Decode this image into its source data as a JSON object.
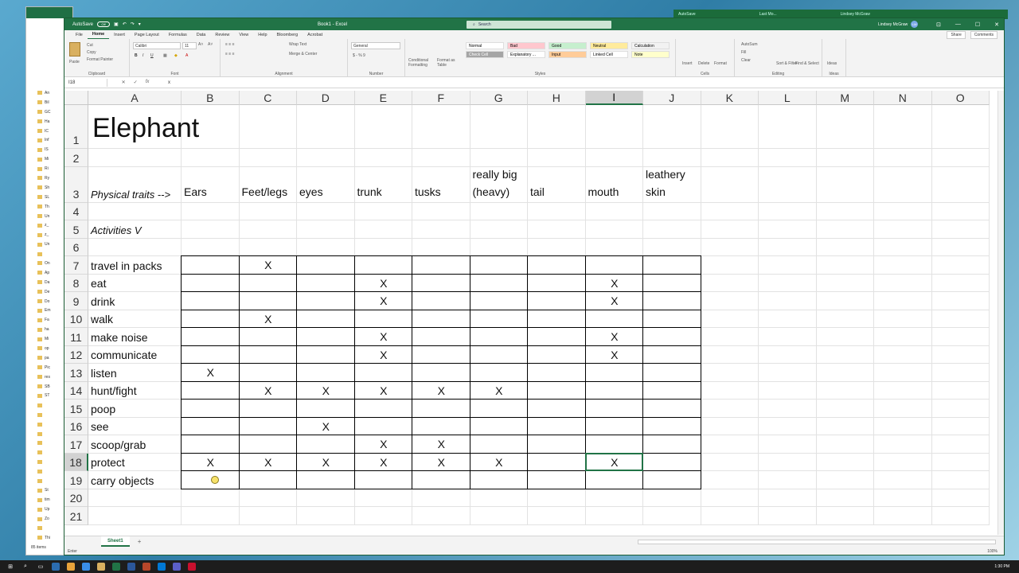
{
  "explorer": {
    "items": [
      "An",
      "Bil",
      "GC",
      "Ha",
      "IC",
      "Inf",
      "IS",
      "Mi",
      "Ri",
      "Ry",
      "Sh",
      "SL",
      "Th",
      "Un",
      "z_",
      "z_",
      "Un",
      "",
      "On",
      "Ap",
      "Da",
      "De",
      "Do",
      "Em",
      "Fa",
      "ha",
      "Mi",
      "op",
      "pa",
      "Pic",
      "res",
      "SB",
      "ST",
      "",
      "",
      "",
      "",
      "",
      "",
      "",
      "",
      "",
      "St",
      "tim",
      "Up",
      "Zo",
      "",
      "Thi"
    ],
    "status": "85 items"
  },
  "bg_window": {
    "left_text": "AutoSave",
    "mid_text": "Last Mo...",
    "user": "Lindsey McGraw"
  },
  "titlebar": {
    "autosave_label": "AutoSave",
    "autosave_state": "Off",
    "doc_title": "Book1 - Excel",
    "search_placeholder": "Search",
    "user_name": "Lindsey McGraw",
    "user_initials": "LM",
    "minimize": "—",
    "restore": "☐",
    "close": "✕"
  },
  "menu": {
    "tabs": [
      "File",
      "Home",
      "Insert",
      "Page Layout",
      "Formulas",
      "Data",
      "Review",
      "View",
      "Help",
      "Bloomberg",
      "Acrobat"
    ],
    "active": "Home",
    "share": "Share",
    "comments": "Comments"
  },
  "ribbon": {
    "clipboard": {
      "label": "Clipboard",
      "paste": "Paste",
      "cut": "Cut",
      "copy": "Copy",
      "format_painter": "Format Painter"
    },
    "font": {
      "label": "Font",
      "name": "Calibri",
      "size": "11",
      "bold": "B",
      "italic": "I",
      "underline": "U"
    },
    "alignment": {
      "label": "Alignment",
      "wrap": "Wrap Text",
      "merge": "Merge & Center"
    },
    "number": {
      "label": "Number",
      "format": "General",
      "symbols": "$ - % 9"
    },
    "styles": {
      "label": "Styles",
      "conditional": "Conditional Formatting",
      "format_as_table": "Format as Table",
      "chips": [
        "Normal",
        "Bad",
        "Good",
        "Neutral",
        "Calculation",
        "Check Cell",
        "Explanatory ...",
        "Input",
        "Linked Cell",
        "Note"
      ]
    },
    "cells": {
      "label": "Cells",
      "insert": "Insert",
      "delete": "Delete",
      "format": "Format"
    },
    "editing": {
      "label": "Editing",
      "autosum": "AutoSum",
      "fill": "Fill",
      "clear": "Clear",
      "sort": "Sort & Filter",
      "find": "Find & Select"
    },
    "ideas": {
      "label": "Ideas",
      "button": "Ideas"
    }
  },
  "formula_bar": {
    "name_box": "I18",
    "cancel": "✕",
    "enter": "✓",
    "fx": "fx",
    "content": "x"
  },
  "sheet": {
    "columns": [
      "A",
      "B",
      "C",
      "D",
      "E",
      "F",
      "G",
      "H",
      "I",
      "J",
      "K",
      "L",
      "M",
      "N",
      "O"
    ],
    "selected_column": "I",
    "selected_row": "18",
    "rows": [
      "1",
      "2",
      "3",
      "4",
      "5",
      "6",
      "7",
      "8",
      "9",
      "10",
      "11",
      "12",
      "13",
      "14",
      "15",
      "16",
      "17",
      "18",
      "19",
      "20",
      "21"
    ],
    "title": "Elephant",
    "traits_label": "Physical traits -->",
    "activities_label": "Activities V",
    "traits": {
      "B": [
        "Ears"
      ],
      "C": [
        "Feet/legs"
      ],
      "D": [
        "eyes"
      ],
      "E": [
        "trunk"
      ],
      "F": [
        "tusks"
      ],
      "G": [
        "really big",
        "(heavy)"
      ],
      "H": [
        "tail"
      ],
      "I": [
        "mouth"
      ],
      "J": [
        "leathery",
        "skin"
      ]
    },
    "activities": [
      {
        "row": "7",
        "label": "travel in packs",
        "x": [
          "C"
        ]
      },
      {
        "row": "8",
        "label": "eat",
        "x": [
          "E",
          "I"
        ]
      },
      {
        "row": "9",
        "label": "drink",
        "x": [
          "E",
          "I"
        ]
      },
      {
        "row": "10",
        "label": "walk",
        "x": [
          "C"
        ]
      },
      {
        "row": "11",
        "label": "make noise",
        "x": [
          "E",
          "I"
        ]
      },
      {
        "row": "12",
        "label": "communicate",
        "x": [
          "E",
          "I"
        ]
      },
      {
        "row": "13",
        "label": "listen",
        "x": [
          "B"
        ]
      },
      {
        "row": "14",
        "label": "hunt/fight",
        "x": [
          "C",
          "D",
          "E",
          "F",
          "G"
        ]
      },
      {
        "row": "15",
        "label": "poop",
        "x": []
      },
      {
        "row": "16",
        "label": "see",
        "x": [
          "D"
        ]
      },
      {
        "row": "17",
        "label": "scoop/grab",
        "x": [
          "E",
          "F"
        ]
      },
      {
        "row": "18",
        "label": "protect",
        "x": [
          "B",
          "C",
          "D",
          "E",
          "F",
          "G",
          "I"
        ]
      },
      {
        "row": "19",
        "label": "carry objects",
        "x": []
      }
    ],
    "x_mark": "X"
  },
  "sheet_tabs": {
    "active": "Sheet1",
    "add": "+"
  },
  "status": {
    "mode": "Enter",
    "zoom": "100%"
  },
  "taskbar": {
    "time": "1:30 PM"
  }
}
